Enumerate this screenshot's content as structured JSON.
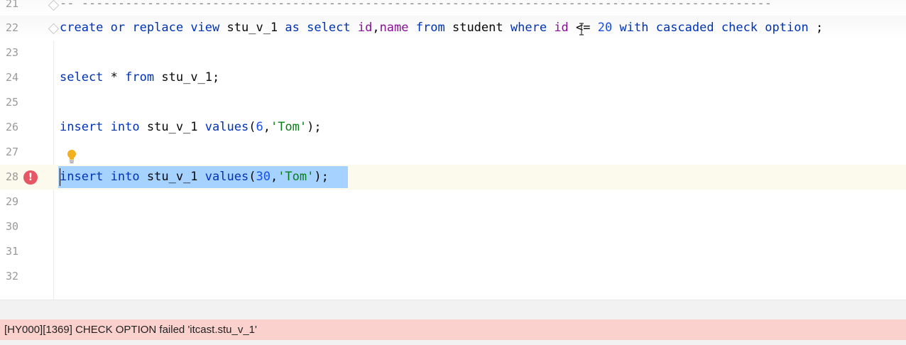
{
  "editor": {
    "lines": {
      "l21": {
        "num": "21",
        "comment": "-- -----------------------------------------------------------------------------------------------"
      },
      "l22": {
        "num": "22"
      },
      "l23": {
        "num": "23"
      },
      "l24": {
        "num": "24"
      },
      "l25": {
        "num": "25"
      },
      "l26": {
        "num": "26"
      },
      "l27": {
        "num": "27"
      },
      "l28": {
        "num": "28"
      },
      "l29": {
        "num": "29"
      },
      "l30": {
        "num": "30"
      },
      "l31": {
        "num": "31"
      },
      "l32": {
        "num": "32"
      }
    },
    "tokens": {
      "create": "create",
      "or": "or",
      "replace": "replace",
      "view": "view",
      "view_name": "stu_v_1",
      "as": "as",
      "select": "select",
      "id": "id",
      "comma": ",",
      "name": "name",
      "from": "from",
      "student": "student",
      "where": "where",
      "id2": "id",
      "lte": "<=",
      "twenty": "20",
      "with": "with",
      "cascaded": "cascaded",
      "check": "check",
      "option": "option",
      "semicolon": ";",
      "select2": "select",
      "star": "*",
      "from2": "from",
      "view_name2": "stu_v_1;",
      "insert": "insert",
      "into": "into",
      "view_name3": "stu_v_1",
      "values": "values",
      "lparen": "(",
      "six": "6",
      "comma2": ",",
      "tom": "'Tom'",
      "rparen": ");",
      "insert2": "insert",
      "into2": "into",
      "view_name4": "stu_v_1",
      "values2": "values",
      "lparen2": "(",
      "thirty": "30",
      "comma3": ",",
      "tom2": "'Tom'",
      "rparen2": ");"
    },
    "error_marker": "!"
  },
  "error_bar": {
    "message": "[HY000][1369] CHECK OPTION failed 'itcast.stu_v_1'"
  },
  "colors": {
    "keyword": "#0033b3",
    "column": "#871094",
    "number": "#1750eb",
    "string": "#067d17",
    "selection": "#a6d2ff",
    "error_bar_bg": "#fbd1cd",
    "error_icon": "#e55765"
  }
}
